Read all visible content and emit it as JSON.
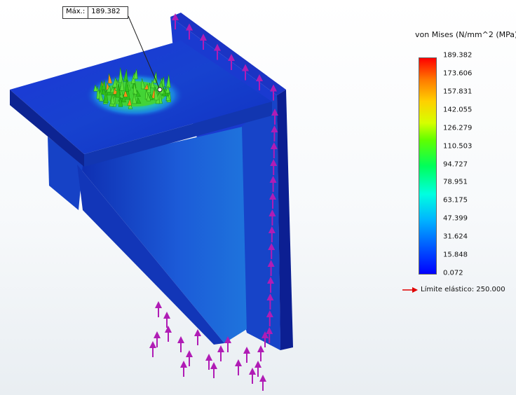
{
  "max_label": {
    "key": "Máx.:",
    "value": "189.382"
  },
  "legend": {
    "title": "von Mises (N/mm^2 (MPa))",
    "ticks": [
      "189.382",
      "173.606",
      "157.831",
      "142.055",
      "126.279",
      "110.503",
      "94.727",
      "78.951",
      "63.175",
      "47.399",
      "31.624",
      "15.848",
      "0.072"
    ],
    "range": [
      0.072,
      189.382
    ],
    "colors": [
      "#0000ff",
      "#00b4ff",
      "#00ff5a",
      "#d6ff00",
      "#ff7a00",
      "#ff0000"
    ]
  },
  "yield": {
    "text": "Límite elástico: 250.000",
    "arrow_color": "#e00000"
  },
  "colors": {
    "model_blue": "#1d3fd0",
    "model_dark": "#0a1c86",
    "hotspot_green": "#3ddc2a",
    "load_arrow": "#b01cb5"
  }
}
